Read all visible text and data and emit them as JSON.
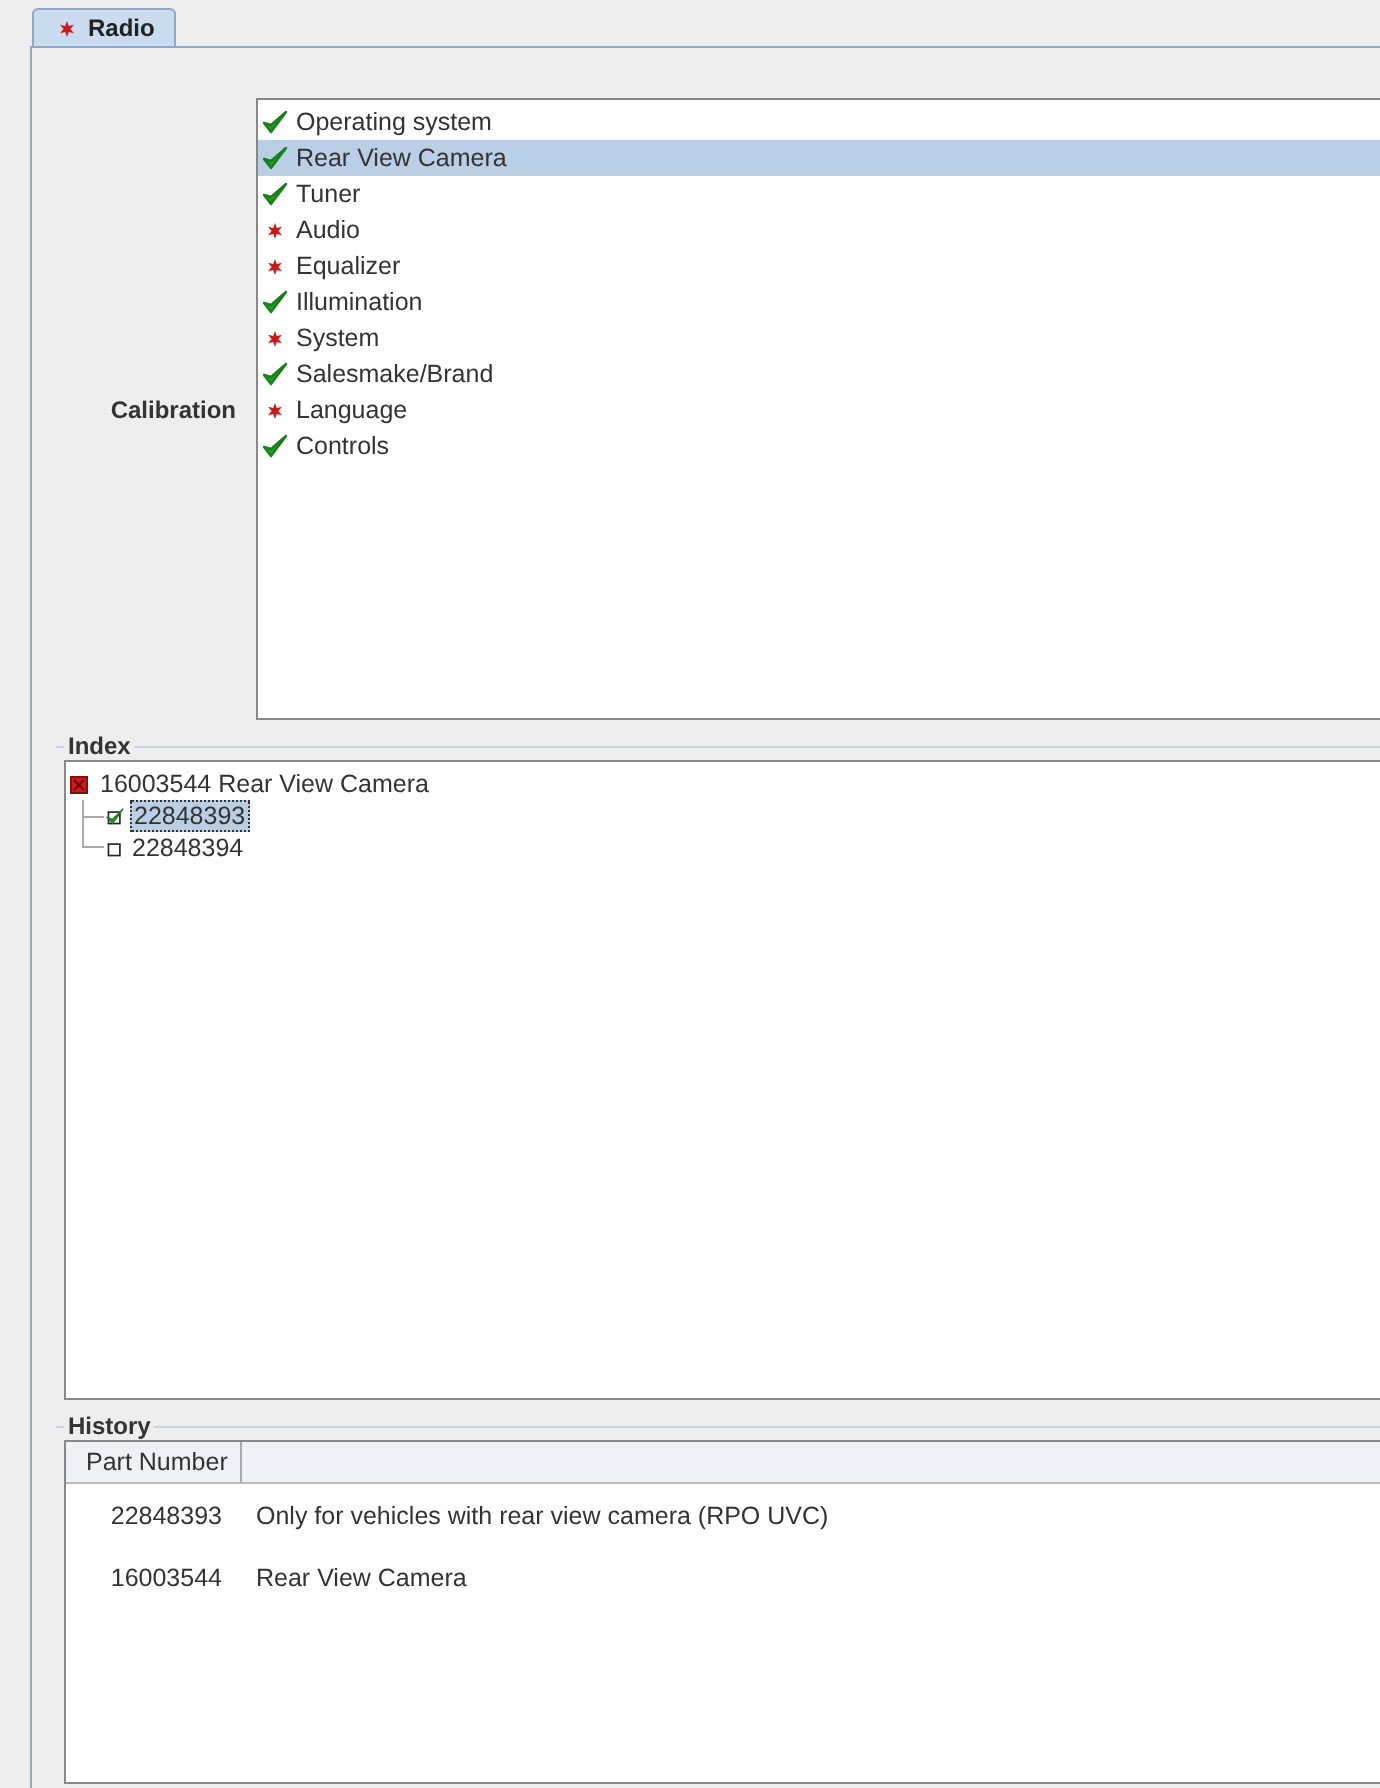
{
  "tabs": [
    {
      "label": "Radio",
      "selected": true,
      "kind": "error"
    }
  ],
  "calibration": {
    "label": "Calibration",
    "items": [
      {
        "label": "Operating system",
        "kind": "ok",
        "selected": false
      },
      {
        "label": "Rear View Camera",
        "kind": "ok",
        "selected": true
      },
      {
        "label": "Tuner",
        "kind": "ok",
        "selected": false
      },
      {
        "label": "Audio",
        "kind": "error",
        "selected": false
      },
      {
        "label": "Equalizer",
        "kind": "error",
        "selected": false
      },
      {
        "label": "Illumination",
        "kind": "ok",
        "selected": false
      },
      {
        "label": "System",
        "kind": "error",
        "selected": false
      },
      {
        "label": "Salesmake/Brand",
        "kind": "ok",
        "selected": false
      },
      {
        "label": "Language",
        "kind": "error",
        "selected": false
      },
      {
        "label": "Controls",
        "kind": "ok",
        "selected": false
      }
    ]
  },
  "index": {
    "title": "Index",
    "tree": [
      {
        "label": "16003544 Rear View Camera",
        "kind": "group",
        "selected": false,
        "children": [
          {
            "label": "22848393",
            "kind": "leaf",
            "checked": true,
            "selected": true
          },
          {
            "label": "22848394",
            "kind": "leaf",
            "checked": false,
            "selected": false
          }
        ]
      }
    ]
  },
  "history": {
    "title": "History",
    "columns": [
      "Part Number"
    ],
    "rows": [
      [
        "22848393",
        "Only for vehicles with rear view camera (RPO UVC)"
      ],
      [
        "16003544",
        "Rear View Camera"
      ]
    ]
  }
}
